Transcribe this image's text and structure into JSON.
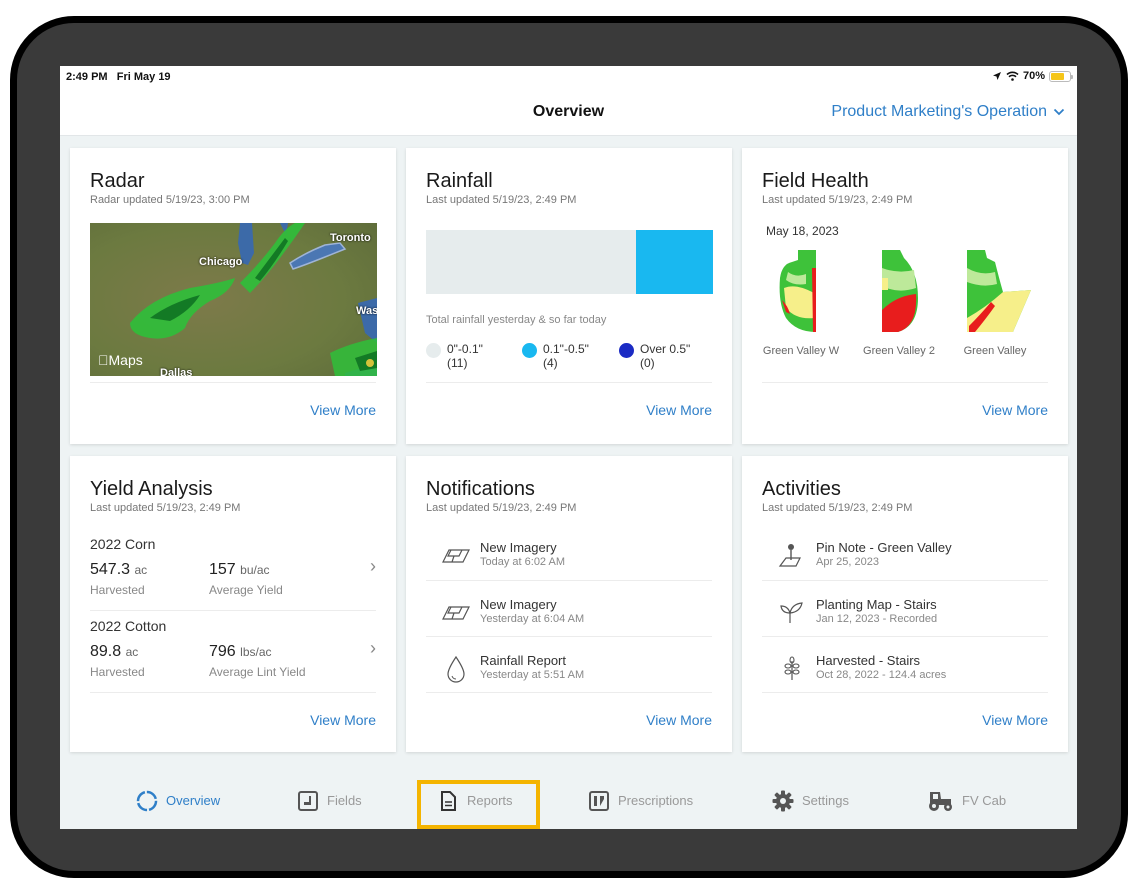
{
  "status_bar": {
    "time": "2:49 PM",
    "date": "Fri May 19",
    "battery_text": "70%",
    "battery_level": 0.7,
    "icons": [
      "location-arrow-icon",
      "wifi-icon",
      "battery-icon"
    ]
  },
  "header": {
    "title": "Overview",
    "operation": "Product Marketing's Operation"
  },
  "cards": {
    "radar": {
      "title": "Radar",
      "subtitle": "Radar updated 5/19/23, 3:00 PM",
      "map_labels": [
        "Toronto",
        "Chicago",
        "Was",
        "Dallas"
      ],
      "maps_attribution": "Maps",
      "view_more": "View More"
    },
    "rainfall": {
      "title": "Rainfall",
      "subtitle": "Last updated 5/19/23, 2:49 PM",
      "caption": "Total rainfall yesterday & so far today",
      "legend": [
        {
          "range": "0\"-0.1\"",
          "count": "(11)",
          "value": 11,
          "color": "#e6eced"
        },
        {
          "range": "0.1\"-0.5\"",
          "count": "(4)",
          "value": 4,
          "color": "#19b8f0"
        },
        {
          "range": "Over 0.5\"",
          "count": "(0)",
          "value": 0,
          "color": "#1b2bc4"
        }
      ],
      "view_more": "View More"
    },
    "field_health": {
      "title": "Field Health",
      "subtitle": "Last updated 5/19/23, 2:49 PM",
      "date": "May 18, 2023",
      "fields": [
        "Green Valley W",
        "Green Valley 2",
        "Green Valley"
      ],
      "view_more": "View More"
    },
    "yield": {
      "title": "Yield Analysis",
      "subtitle": "Last updated 5/19/23, 2:49 PM",
      "items": [
        {
          "crop": "2022 Corn",
          "area": "547.3",
          "area_unit": "ac",
          "area_label": "Harvested",
          "yield": "157",
          "yield_unit": "bu/ac",
          "yield_label": "Average Yield"
        },
        {
          "crop": "2022 Cotton",
          "area": "89.8",
          "area_unit": "ac",
          "area_label": "Harvested",
          "yield": "796",
          "yield_unit": "lbs/ac",
          "yield_label": "Average Lint Yield"
        }
      ],
      "view_more": "View More"
    },
    "notifications": {
      "title": "Notifications",
      "subtitle": "Last updated 5/19/23, 2:49 PM",
      "items": [
        {
          "title": "New Imagery",
          "sub": "Today at 6:02 AM",
          "icon": "imagery-icon"
        },
        {
          "title": "New Imagery",
          "sub": "Yesterday at 6:04 AM",
          "icon": "imagery-icon"
        },
        {
          "title": "Rainfall Report",
          "sub": "Yesterday at 5:51 AM",
          "icon": "raindrop-icon"
        }
      ],
      "view_more": "View More"
    },
    "activities": {
      "title": "Activities",
      "subtitle": "Last updated 5/19/23, 2:49 PM",
      "items": [
        {
          "title": "Pin Note - Green Valley",
          "sub": "Apr 25, 2023",
          "icon": "pin-note-icon"
        },
        {
          "title": "Planting Map - Stairs",
          "sub": "Jan 12, 2023 - Recorded",
          "icon": "seedling-icon"
        },
        {
          "title": "Harvested - Stairs",
          "sub": "Oct 28, 2022 - 124.4 acres",
          "icon": "wheat-icon"
        }
      ],
      "view_more": "View More"
    }
  },
  "tabs": [
    {
      "label": "Overview",
      "icon": "overview-ring-icon",
      "active": true
    },
    {
      "label": "Fields",
      "icon": "fields-icon",
      "active": false
    },
    {
      "label": "Reports",
      "icon": "report-document-icon",
      "active": false,
      "highlighted": true
    },
    {
      "label": "Prescriptions",
      "icon": "prescriptions-icon",
      "active": false
    },
    {
      "label": "Settings",
      "icon": "gear-icon",
      "active": false
    },
    {
      "label": "FV Cab",
      "icon": "tractor-icon",
      "active": false
    }
  ],
  "colors": {
    "accent": "#2f7fc8",
    "highlight": "#f4b400"
  }
}
